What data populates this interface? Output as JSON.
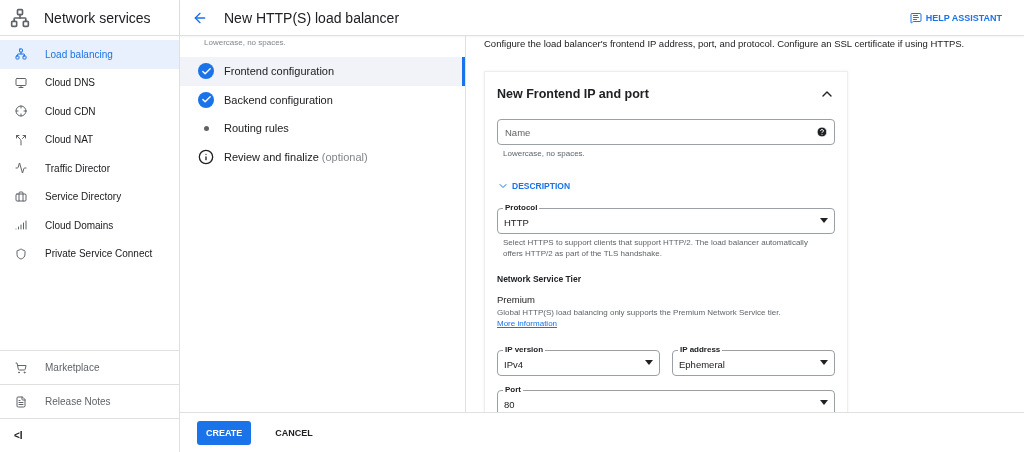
{
  "sidebar": {
    "title": "Network services",
    "items": [
      {
        "label": "Load balancing",
        "selected": true
      },
      {
        "label": "Cloud DNS",
        "selected": false
      },
      {
        "label": "Cloud CDN",
        "selected": false
      },
      {
        "label": "Cloud NAT",
        "selected": false
      },
      {
        "label": "Traffic Director",
        "selected": false
      },
      {
        "label": "Service Directory",
        "selected": false
      },
      {
        "label": "Cloud Domains",
        "selected": false
      },
      {
        "label": "Private Service Connect",
        "selected": false
      }
    ],
    "footer_items": [
      {
        "label": "Marketplace"
      },
      {
        "label": "Release Notes"
      }
    ],
    "collapse": "<I"
  },
  "header": {
    "title": "New HTTP(S) load balancer",
    "help": "HELP ASSISTANT"
  },
  "steps": {
    "hint": "Lowercase, no spaces.",
    "items": [
      {
        "label": "Frontend configuration",
        "kind": "done",
        "selected": true
      },
      {
        "label": "Backend configuration",
        "kind": "done",
        "selected": false
      },
      {
        "label": "Routing rules",
        "kind": "pending",
        "selected": false
      },
      {
        "label": "Review and finalize",
        "suffix": "(optional)",
        "kind": "info",
        "selected": false
      }
    ]
  },
  "intro": "Configure the load balancer's frontend IP address, port, and protocol. Configure an SSL certificate if using HTTPS.",
  "card": {
    "title": "New Frontend IP and port",
    "expanded": true,
    "name_field": {
      "placeholder": "Name",
      "hint": "Lowercase, no spaces."
    },
    "description_toggle": "DESCRIPTION",
    "protocol": {
      "label": "Protocol",
      "value": "HTTP",
      "hint": "Select HTTPS to support clients that support HTTP/2. The load balancer automatically offers HTTP/2 as part of the TLS handshake."
    },
    "tier": {
      "heading": "Network Service Tier",
      "value": "Premium",
      "note": "Global HTTP(S) load balancing only supports the Premium Network Service tier.",
      "link": "More information"
    },
    "ip_version": {
      "label": "IP version",
      "value": "IPv4"
    },
    "ip_address": {
      "label": "IP address",
      "value": "Ephemeral"
    },
    "port": {
      "label": "Port",
      "value": "80"
    }
  },
  "actions": {
    "primary": "CREATE",
    "secondary": "CANCEL"
  }
}
